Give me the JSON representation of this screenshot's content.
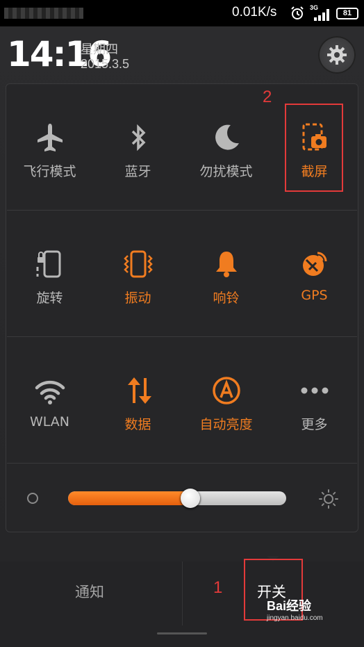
{
  "status_bar": {
    "speed": "0.01K/s",
    "network": "3G",
    "battery": "81"
  },
  "header": {
    "time": "14:16",
    "weekday": "星期四",
    "date": "2015.3.5"
  },
  "toggles": [
    {
      "label": "飞行模式",
      "icon": "airplane-icon",
      "state": "off"
    },
    {
      "label": "蓝牙",
      "icon": "bluetooth-icon",
      "state": "off"
    },
    {
      "label": "勿扰模式",
      "icon": "moon-icon",
      "state": "off"
    },
    {
      "label": "截屏",
      "icon": "screenshot-icon",
      "state": "on"
    },
    {
      "label": "旋转",
      "icon": "rotate-lock-icon",
      "state": "off"
    },
    {
      "label": "振动",
      "icon": "vibrate-icon",
      "state": "on"
    },
    {
      "label": "响铃",
      "icon": "bell-icon",
      "state": "on"
    },
    {
      "label": "GPS",
      "icon": "gps-icon",
      "state": "on"
    },
    {
      "label": "WLAN",
      "icon": "wifi-icon",
      "state": "off"
    },
    {
      "label": "数据",
      "icon": "data-arrows-icon",
      "state": "on"
    },
    {
      "label": "自动亮度",
      "icon": "auto-brightness-icon",
      "state": "on"
    },
    {
      "label": "更多",
      "icon": "more-dots-icon",
      "state": "off"
    }
  ],
  "brightness": {
    "level": 0.56
  },
  "tabs": {
    "notifications": "通知",
    "toggles": "开关"
  },
  "annotations": {
    "one": "1",
    "two": "2"
  },
  "watermark": {
    "brand": "Bai经验",
    "site": "jingyan.baidu.com"
  },
  "colors": {
    "accent": "#f07c20",
    "inactive": "#b8b8b8",
    "annotation": "#e33a3a"
  }
}
